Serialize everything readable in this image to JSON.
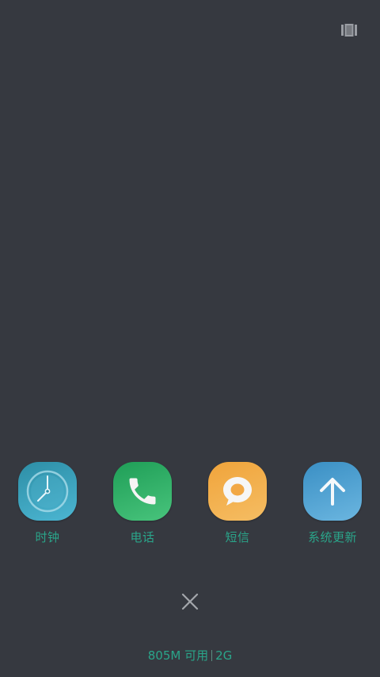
{
  "header": {
    "view_toggle_icon": "multi-window-icon"
  },
  "recent_apps": [
    {
      "label": "时钟",
      "icon": "clock-icon",
      "color": "#3aa3bf"
    },
    {
      "label": "电话",
      "icon": "phone-icon",
      "color": "#2bb068"
    },
    {
      "label": "短信",
      "icon": "message-icon",
      "color": "#f2ad4a"
    },
    {
      "label": "系统更新",
      "icon": "upload-arrow-icon",
      "color": "#4a9fd0"
    }
  ],
  "footer": {
    "close_icon": "close-icon",
    "memory_available": "805M 可用",
    "memory_total": "2G"
  },
  "colors": {
    "background": "#363940",
    "label_accent": "#2aa58a"
  }
}
